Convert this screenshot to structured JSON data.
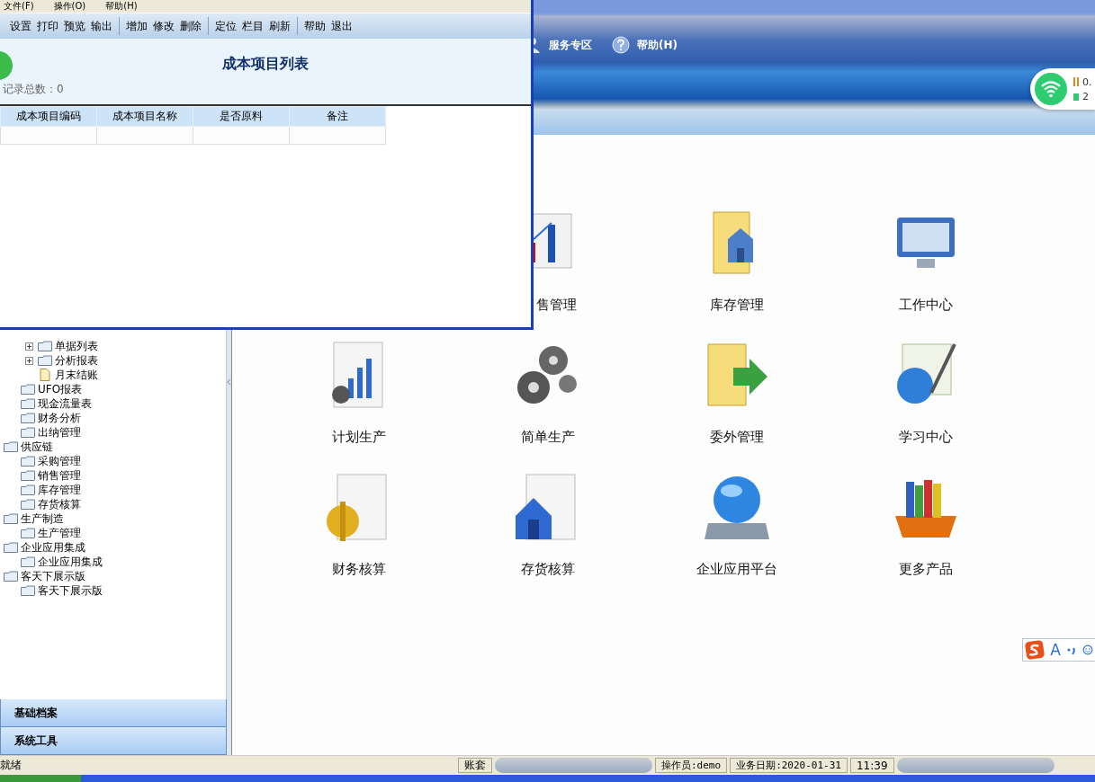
{
  "main_nav": [
    {
      "label": "服务专区",
      "kind": "person"
    },
    {
      "label": "帮助(H)",
      "kind": "help"
    }
  ],
  "network_widget": {
    "speed": "0.",
    "devices": "2"
  },
  "tree": [
    {
      "children": [
        {
          "children": [
            {
              "label": "单据列表",
              "kind": "collapsed"
            },
            {
              "label": "分析报表",
              "kind": "collapsed"
            },
            {
              "label": "月末结账",
              "kind": "document"
            }
          ]
        },
        {
          "label": "UFO报表",
          "kind": "folder"
        },
        {
          "label": "现金流量表",
          "kind": "folder"
        },
        {
          "label": "财务分析",
          "kind": "folder"
        },
        {
          "label": "出纳管理",
          "kind": "folder"
        }
      ]
    },
    {
      "label": "供应链",
      "kind": "folder",
      "children": [
        {
          "label": "采购管理",
          "kind": "folder"
        },
        {
          "label": "销售管理",
          "kind": "folder"
        },
        {
          "label": "库存管理",
          "kind": "folder"
        },
        {
          "label": "存货核算",
          "kind": "folder"
        }
      ]
    },
    {
      "label": "生产制造",
      "kind": "folder",
      "children": [
        {
          "label": "生产管理",
          "kind": "folder"
        }
      ]
    },
    {
      "label": "企业应用集成",
      "kind": "folder",
      "children": [
        {
          "label": "企业应用集成",
          "kind": "folder"
        }
      ]
    },
    {
      "label": "客天下展示版",
      "kind": "folder",
      "children": [
        {
          "label": "客天下展示版",
          "kind": "folder"
        }
      ]
    }
  ],
  "sidebar_sections": [
    "基础档案",
    "系统工具"
  ],
  "modules": [
    {
      "label": "售管理",
      "kind": "chart"
    },
    {
      "label": "库存管理",
      "kind": "folder"
    },
    {
      "label": "工作中心",
      "kind": "monitor"
    },
    {
      "label": "计划生产",
      "kind": "report"
    },
    {
      "label": "简单生产",
      "kind": "gears"
    },
    {
      "label": "委外管理",
      "kind": "folder-arrow"
    },
    {
      "label": "学习中心",
      "kind": "globe-pen"
    },
    {
      "label": "财务核算",
      "kind": "dollar"
    },
    {
      "label": "存货核算",
      "kind": "house"
    },
    {
      "label": "企业应用平台",
      "kind": "disk"
    },
    {
      "label": "更多产品",
      "kind": "books"
    }
  ],
  "ime_toolbar": {
    "mode": "A"
  },
  "status_bar": [
    {
      "text": "就绪",
      "kind": "wide"
    },
    {
      "text": "账套",
      "kind": "redacted"
    },
    {
      "text": "操作员:demo",
      "kind": "plain"
    },
    {
      "text": "业务日期:2020-01-31",
      "kind": "plain"
    },
    {
      "text": "11:39",
      "kind": "redacted"
    }
  ],
  "dialog": {
    "menu": [
      "文件(F)",
      "操作(O)",
      "帮助(H)"
    ],
    "toolbar": [
      [
        "设置",
        "打印",
        "预览",
        "输出"
      ],
      [
        "增加",
        "修改",
        "删除"
      ],
      [
        "定位",
        "栏目",
        "刷新"
      ],
      [
        "帮助",
        "退出"
      ]
    ],
    "title": "成本项目列表",
    "record_count": "记录总数：0",
    "table": {
      "columns": [
        "成本项目编码",
        "成本项目名称",
        "是否原料",
        "备注"
      ]
    }
  }
}
